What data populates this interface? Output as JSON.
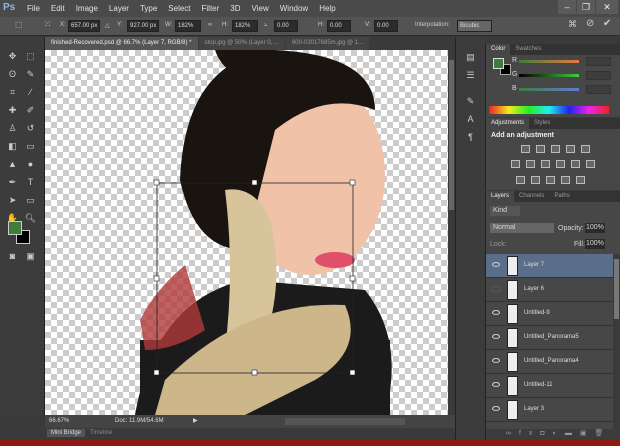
{
  "app": {
    "logo": "Ps",
    "menus": [
      "File",
      "Edit",
      "Image",
      "Layer",
      "Type",
      "Select",
      "Filter",
      "3D",
      "View",
      "Window",
      "Help"
    ],
    "window_buttons": [
      "–",
      "❐",
      "✕"
    ]
  },
  "options": {
    "x_label": "X:",
    "x": "657.00 px",
    "y_label": "Y:",
    "y": "927.00 px",
    "w_label": "W:",
    "w": "182%",
    "h_label": "H:",
    "h": "182%",
    "angle": "0.00",
    "hskew_label": "H:",
    "hskew": "0.00",
    "vskew_label": "V:",
    "vskew": "0.00",
    "interp_label": "Interpolation:",
    "interp": "Bicubic"
  },
  "tabs": [
    {
      "label": "finished-Recovered.psd @ 66.7% (Layer 7, RGB/8) *"
    },
    {
      "label": "stop.jpg @ 50% (Layer 0, ..."
    },
    {
      "label": "600-03017685m.jpg @ 1..."
    }
  ],
  "status": {
    "zoom": "66.67%",
    "doc": "Doc: 11.9M/54.6M"
  },
  "bottom_tabs": [
    "Mini Bridge",
    "Timeline"
  ],
  "color_panel": {
    "tabs": [
      "Color",
      "Swatches"
    ],
    "channels": [
      "R",
      "G",
      "B"
    ],
    "fg": "#3e7d3e",
    "bg": "#000000"
  },
  "adjustments": {
    "tabs": [
      "Adjustments",
      "Styles"
    ],
    "heading": "Add an adjustment"
  },
  "layers": {
    "tabs": [
      "Layers",
      "Channels",
      "Paths"
    ],
    "filter": "Kind",
    "blend": "Normal",
    "opacity_label": "Opacity:",
    "opacity": "100%",
    "lock_label": "Lock:",
    "fill_label": "Fill:",
    "fill": "100%",
    "items": [
      {
        "name": "Layer 7",
        "visible": true,
        "selected": true
      },
      {
        "name": "Layer 6",
        "visible": false
      },
      {
        "name": "Untitled-9",
        "visible": true
      },
      {
        "name": "Untitled_Panorama5",
        "visible": true
      },
      {
        "name": "Untitled_Panorama4",
        "visible": true
      },
      {
        "name": "Untitled-11",
        "visible": true
      },
      {
        "name": "Layer 3",
        "visible": true
      }
    ]
  }
}
